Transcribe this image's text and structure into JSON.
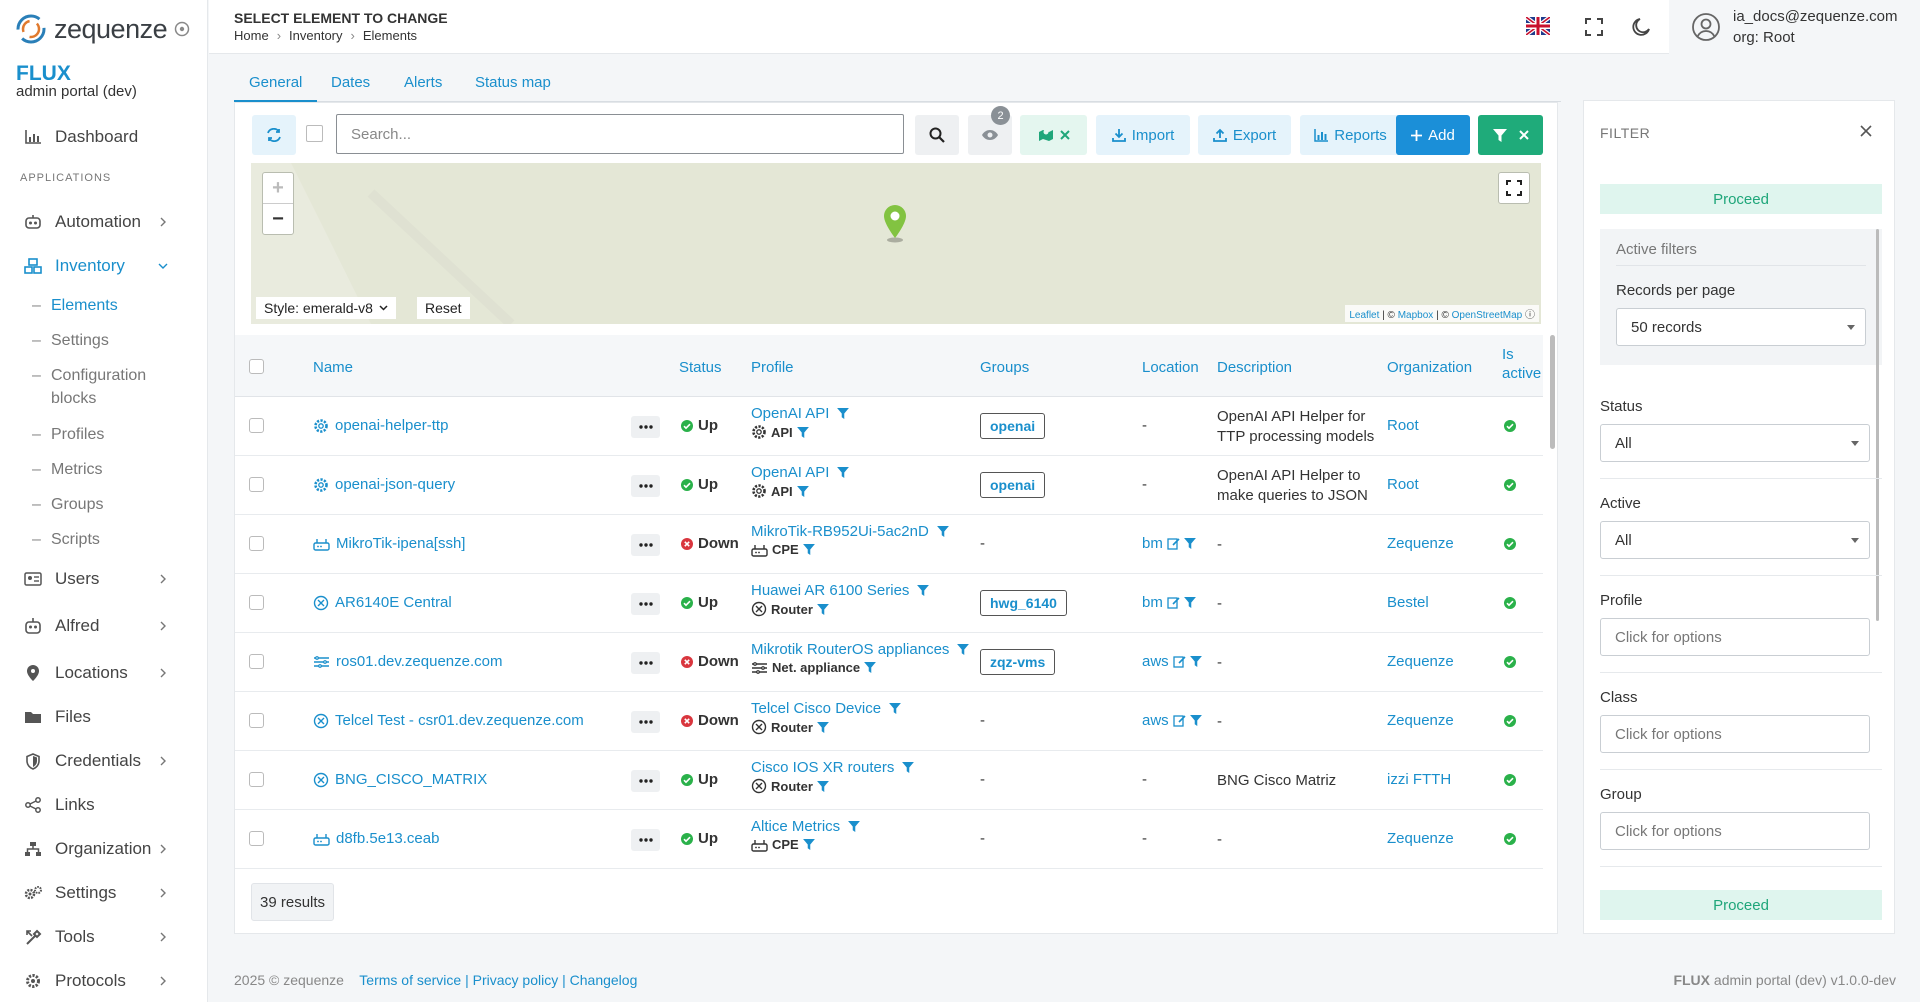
{
  "app": {
    "logo_text": "zequenze",
    "brand_title": "FLUX",
    "brand_subtitle": "admin portal (dev)"
  },
  "sidebar": {
    "dashboard": "Dashboard",
    "section_label": "APPLICATIONS",
    "automation": "Automation",
    "inventory": "Inventory",
    "inventory_items": {
      "elements": "Elements",
      "settings": "Settings",
      "configuration_blocks_line1": "Configuration",
      "configuration_blocks_line2": "blocks",
      "profiles": "Profiles",
      "metrics": "Metrics",
      "groups": "Groups",
      "scripts": "Scripts"
    },
    "users": "Users",
    "alfred": "Alfred",
    "locations": "Locations",
    "files": "Files",
    "credentials": "Credentials",
    "links": "Links",
    "organization": "Organization",
    "settings": "Settings",
    "tools": "Tools",
    "protocols": "Protocols"
  },
  "header": {
    "page_title": "SELECT ELEMENT TO CHANGE",
    "breadcrumb": [
      "Home",
      "Inventory",
      "Elements"
    ],
    "user_email": "ia_docs@zequenze.com",
    "user_org": "org: Root"
  },
  "tabs": [
    "General",
    "Dates",
    "Alerts",
    "Status map"
  ],
  "toolbar": {
    "search_placeholder": "Search...",
    "view_badge": "2",
    "import": "Import",
    "export": "Export",
    "reports": "Reports",
    "add": "Add"
  },
  "map": {
    "style_label": "Style: emerald-v8",
    "reset": "Reset",
    "attr_leaflet": "Leaflet",
    "attr_sep1": " | © ",
    "attr_mapbox": "Mapbox",
    "attr_sep2": " | © ",
    "attr_osm": "OpenStreetMap"
  },
  "table": {
    "columns": {
      "name": "Name",
      "status": "Status",
      "profile": "Profile",
      "groups": "Groups",
      "location": "Location",
      "description": "Description",
      "organization": "Organization",
      "is_active_line1": "Is",
      "is_active_line2": "active"
    },
    "rows": [
      {
        "name": "openai-helper-ttp",
        "icon": "gear-icon",
        "status": "Up",
        "profile": "OpenAI API",
        "profile_type": "API",
        "type_icon": "gear-icon",
        "group": "openai",
        "location": "-",
        "description_1": "OpenAI API Helper for",
        "description_2": "TTP processing models",
        "organization": "Root"
      },
      {
        "name": "openai-json-query",
        "icon": "gear-icon",
        "status": "Up",
        "profile": "OpenAI API",
        "profile_type": "API",
        "type_icon": "gear-icon",
        "group": "openai",
        "location": "-",
        "description_1": "OpenAI API Helper to",
        "description_2": "make queries to JSON",
        "organization": "Root"
      },
      {
        "name": "MikroTik-ipena[ssh]",
        "icon": "cpe-icon",
        "status": "Down",
        "profile": "MikroTik-RB952Ui-5ac2nD",
        "profile_type": "CPE",
        "type_icon": "cpe-icon",
        "group": "-",
        "location": "bm",
        "description_1": "-",
        "description_2": "",
        "organization": "Zequenze"
      },
      {
        "name": "AR6140E Central",
        "icon": "router-icon",
        "status": "Up",
        "profile": "Huawei AR 6100 Series",
        "profile_type": "Router",
        "type_icon": "router-icon",
        "group": "hwg_6140",
        "location": "bm",
        "description_1": "-",
        "description_2": "",
        "organization": "Bestel"
      },
      {
        "name": "ros01.dev.zequenze.com",
        "icon": "appliance-icon",
        "status": "Down",
        "profile": "Mikrotik RouterOS appliances",
        "profile_type": "Net. appliance",
        "type_icon": "appliance-icon",
        "group": "zqz-vms",
        "location": "aws",
        "description_1": "-",
        "description_2": "",
        "organization": "Zequenze"
      },
      {
        "name": "Telcel Test - csr01.dev.zequenze.com",
        "icon": "router-icon",
        "status": "Down",
        "profile": "Telcel Cisco Device",
        "profile_type": "Router",
        "type_icon": "router-icon",
        "group": "-",
        "location": "aws",
        "description_1": "-",
        "description_2": "",
        "organization": "Zequenze"
      },
      {
        "name": "BNG_CISCO_MATRIX",
        "icon": "router-icon",
        "status": "Up",
        "profile": "Cisco IOS XR routers",
        "profile_type": "Router",
        "type_icon": "router-icon",
        "group": "-",
        "location": "-",
        "description_1": "BNG Cisco Matriz",
        "description_2": "",
        "organization": "izzi FTTH"
      },
      {
        "name": "d8fb.5e13.ceab",
        "icon": "cpe-icon",
        "status": "Up",
        "profile": "Altice Metrics",
        "profile_type": "CPE",
        "type_icon": "cpe-icon",
        "group": "-",
        "location": "-",
        "description_1": "-",
        "description_2": "",
        "organization": "Zequenze"
      }
    ],
    "results": "39 results"
  },
  "filter": {
    "title": "FILTER",
    "proceed": "Proceed",
    "active_filters": "Active filters",
    "records_label": "Records per page",
    "records_value": "50 records",
    "status_label": "Status",
    "status_value": "All",
    "active_label": "Active",
    "active_value": "All",
    "profile_label": "Profile",
    "class_label": "Class",
    "group_label": "Group",
    "click_for_options": "Click for options"
  },
  "footer": {
    "copyright": "2025 © zequenze",
    "terms": "Terms of service",
    "privacy": "Privacy policy",
    "changelog": "Changelog",
    "right_brand": "FLUX",
    "right_text": " admin portal (dev) v1.0.0-dev"
  },
  "colors": {
    "accent": "#1a8fcc",
    "success": "#1fab7a",
    "status_up": "#2ab14a",
    "status_down": "#d9363e"
  }
}
